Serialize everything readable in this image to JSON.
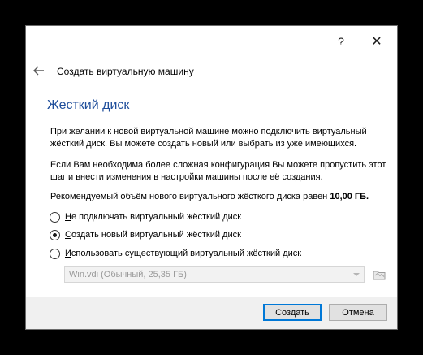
{
  "titlebar": {
    "help_label": "?",
    "close_label": "✕"
  },
  "wizard": {
    "title": "Создать виртуальную машину",
    "heading": "Жесткий диск",
    "para1": "При желании к новой виртуальной машине можно подключить виртуальный жёсткий диск. Вы можете создать новый или выбрать из уже имеющихся.",
    "para2": "Если Вам необходима более сложная конфигурация Вы можете пропустить этот шаг и внести изменения в настройки машины после её создания.",
    "para3_prefix": "Рекомендуемый объём нового виртуального жёсткого диска равен ",
    "para3_value": "10,00 ГБ."
  },
  "options": [
    {
      "accel": "Н",
      "rest": "е подключать виртуальный жёсткий диск",
      "selected": false
    },
    {
      "accel": "С",
      "rest": "оздать новый виртуальный жёсткий диск",
      "selected": true
    },
    {
      "accel": "И",
      "rest": "спользовать существующий виртуальный жёсткий диск",
      "selected": false
    }
  ],
  "existing_disk": {
    "value": "Win.vdi (Обычный, 25,35 ГБ)",
    "enabled": false
  },
  "footer": {
    "create_label": "Создать",
    "cancel_label": "Отмена"
  },
  "colors": {
    "heading": "#1f4e9b",
    "primary_border": "#0078d7",
    "footer_bg": "#f0f0f0"
  },
  "icons": {
    "back": "back-arrow-icon",
    "folder": "folder-icon",
    "combo_arrow": "chevron-down-icon"
  }
}
